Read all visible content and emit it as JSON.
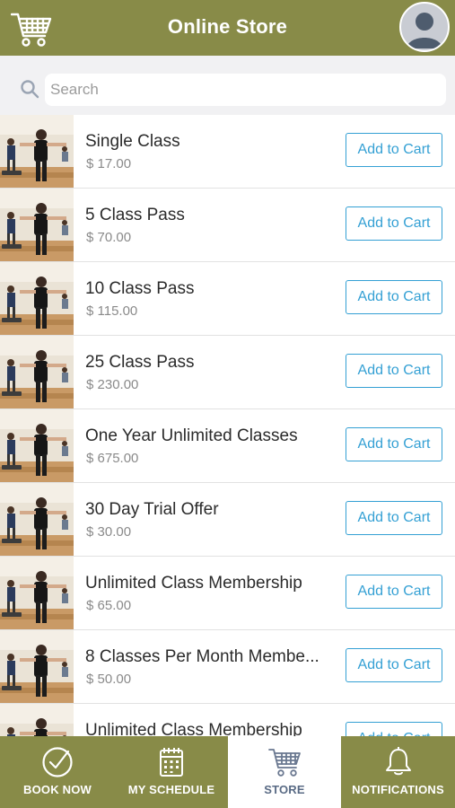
{
  "header": {
    "title": "Online Store"
  },
  "search": {
    "placeholder": "Search"
  },
  "products": [
    {
      "name": "Single Class",
      "price": "$ 17.00",
      "button": "Add to Cart"
    },
    {
      "name": "5 Class Pass",
      "price": "$ 70.00",
      "button": "Add to Cart"
    },
    {
      "name": "10 Class Pass",
      "price": "$ 115.00",
      "button": "Add to Cart"
    },
    {
      "name": "25 Class Pass",
      "price": "$ 230.00",
      "button": "Add to Cart"
    },
    {
      "name": "One Year Unlimited Classes",
      "price": "$ 675.00",
      "button": "Add to Cart"
    },
    {
      "name": "30 Day Trial Offer",
      "price": "$ 30.00",
      "button": "Add to Cart"
    },
    {
      "name": "Unlimited Class Membership",
      "price": "$ 65.00",
      "button": "Add to Cart"
    },
    {
      "name": "8 Classes Per Month Membe...",
      "price": "$ 50.00",
      "button": "Add to Cart"
    },
    {
      "name": "Unlimited Class Membership",
      "price": "",
      "button": "Add to Cart"
    }
  ],
  "nav": [
    {
      "label": "BOOK NOW",
      "icon": "check-circle-icon"
    },
    {
      "label": "MY SCHEDULE",
      "icon": "calendar-icon"
    },
    {
      "label": "STORE",
      "icon": "cart-icon",
      "active": true
    },
    {
      "label": "NOTIFICATIONS",
      "icon": "bell-icon"
    }
  ],
  "colors": {
    "brand": "#888b48",
    "accent": "#34a0d4",
    "active_label": "#5a6b85"
  }
}
